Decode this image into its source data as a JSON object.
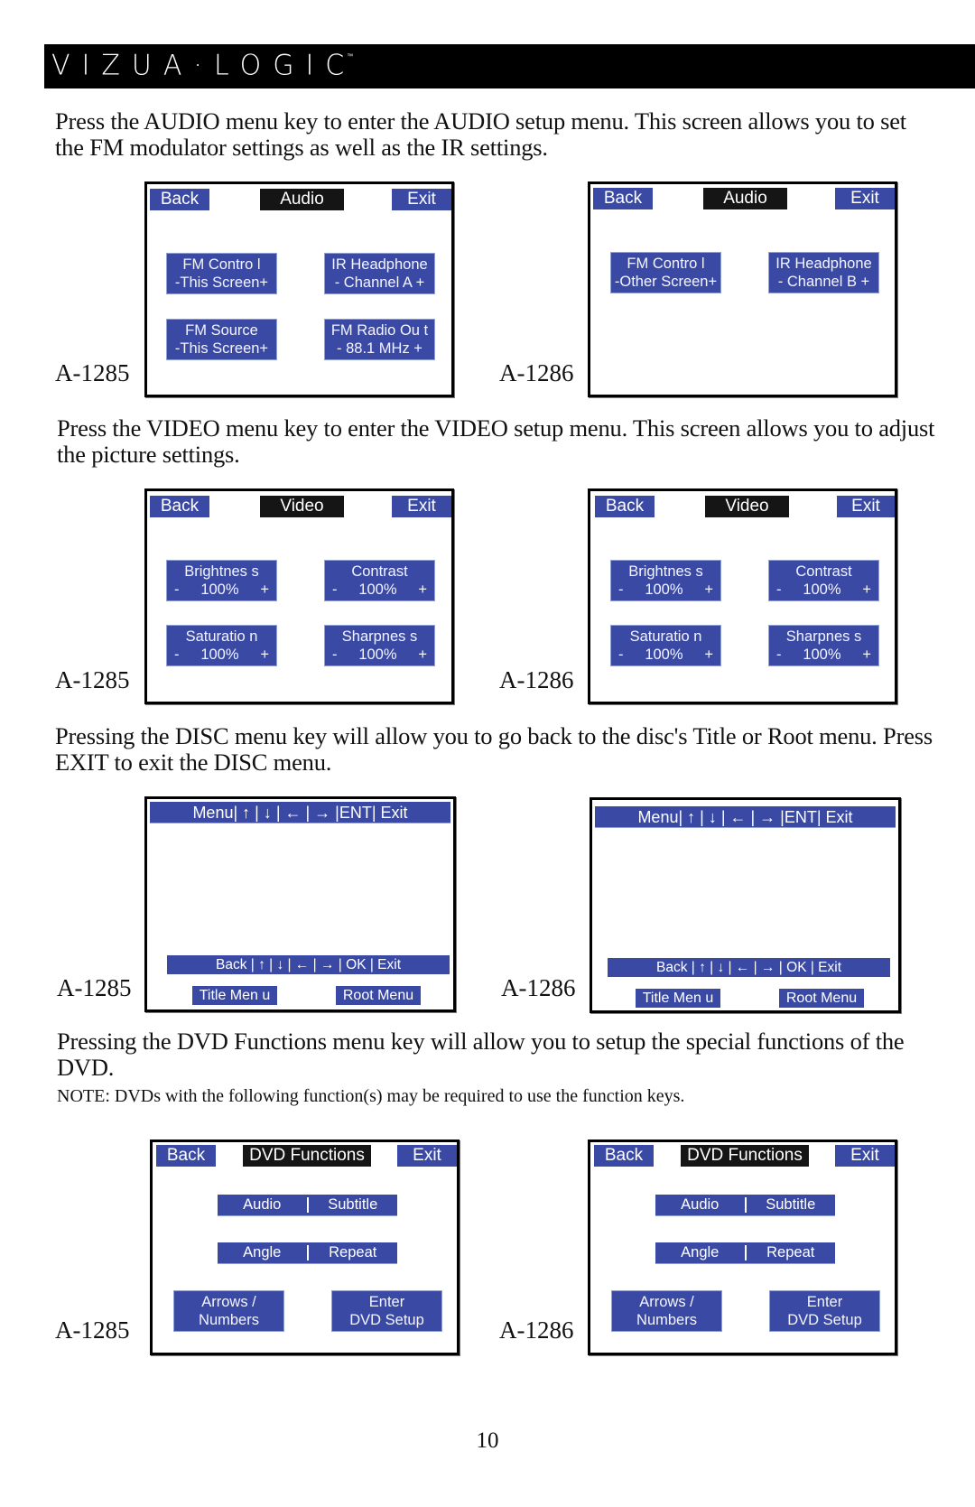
{
  "header": {
    "logo": "VIZUA·LOGIC",
    "trademark": "™"
  },
  "sections": {
    "audio": {
      "text": "Press the AUDIO menu key to enter the AUDIO setup menu.  This screen allows you to set the FM modulator settings as well as the IR settings.",
      "screens": [
        {
          "model": "A-1285",
          "back": "Back",
          "title": "Audio",
          "exit": "Exit",
          "buttons": [
            {
              "line1": "FM Contro l",
              "line2": "-This Screen+"
            },
            {
              "line1": "IR Headphone",
              "line2": "- Channel  A +"
            },
            {
              "line1": "FM Source",
              "line2": "-This Screen+"
            },
            {
              "line1": "FM Radio Ou t",
              "line2": "-  88.1 MHz  +"
            }
          ]
        },
        {
          "model": "A-1286",
          "back": "Back",
          "title": "Audio",
          "exit": "Exit",
          "buttons": [
            {
              "line1": "FM Contro l",
              "line2": "-Other Screen+"
            },
            {
              "line1": "IR Headphone",
              "line2": "- Channel B +"
            }
          ]
        }
      ]
    },
    "video": {
      "text": "Press the VIDEO menu key to enter the VIDEO setup menu.  This screen allows you to adjust the picture settings.",
      "screens": [
        {
          "model": "A-1285",
          "back": "Back",
          "title": "Video",
          "exit": "Exit",
          "buttons": [
            {
              "label": "Brightnes s",
              "minus": "-",
              "value": "100%",
              "plus": "+"
            },
            {
              "label": "Contrast",
              "minus": "-",
              "value": "100%",
              "plus": "+"
            },
            {
              "label": "Saturatio n",
              "minus": "-",
              "value": "100%",
              "plus": "+"
            },
            {
              "label": "Sharpnes s",
              "minus": "-",
              "value": "100%",
              "plus": "+"
            }
          ]
        },
        {
          "model": "A-1286",
          "back": "Back",
          "title": "Video",
          "exit": "Exit",
          "buttons": [
            {
              "label": "Brightnes s",
              "minus": "-",
              "value": "100%",
              "plus": "+"
            },
            {
              "label": "Contrast",
              "minus": "-",
              "value": "100%",
              "plus": "+"
            },
            {
              "label": "Saturatio n",
              "minus": "-",
              "value": "100%",
              "plus": "+"
            },
            {
              "label": "Sharpnes s",
              "minus": "-",
              "value": "100%",
              "plus": "+"
            }
          ]
        }
      ]
    },
    "disc": {
      "text": "Pressing the DISC menu key will allow you to go back to the disc's Title or Root menu. Press EXIT to exit the DISC menu.",
      "screens": [
        {
          "model": "A-1285",
          "top_bar": "Menu|  ↑  |  ↓  |  ←  |  →  |ENT| Exit",
          "bottom_bar": "Back |  ↑  |  ↓  |  ←  |  →  | OK  | Exit",
          "title_menu": "Title Men u",
          "root_menu": "Root Menu"
        },
        {
          "model": "A-1286",
          "top_bar": "Menu|  ↑  |  ↓  |  ←  |  →  |ENT| Exit",
          "bottom_bar": "Back |  ↑  |  ↓  |  ←  |  →  | OK  | Exit",
          "title_menu": "Title Men u",
          "root_menu": "Root Menu"
        }
      ]
    },
    "dvd": {
      "text": "Pressing the DVD Functions menu key will allow you to setup the special functions of the DVD.",
      "note": "NOTE: DVDs with the following function(s) may be required to use the function keys.",
      "screens": [
        {
          "model": "A-1285",
          "back": "Back",
          "title": "DVD Functions",
          "exit": "Exit",
          "row1": [
            "Audio",
            "Subtitle"
          ],
          "row2": [
            "Angle",
            "Repeat"
          ],
          "arrows": {
            "line1": "Arrows /",
            "line2": "Numbers"
          },
          "setup": {
            "line1": "Enter",
            "line2": "DVD Setup"
          }
        },
        {
          "model": "A-1286",
          "back": "Back",
          "title": "DVD Functions",
          "exit": "Exit",
          "row1": [
            "Audio",
            "Subtitle"
          ],
          "row2": [
            "Angle",
            "Repeat"
          ],
          "arrows": {
            "line1": "Arrows /",
            "line2": "Numbers"
          },
          "setup": {
            "line1": "Enter",
            "line2": "DVD Setup"
          }
        }
      ]
    }
  },
  "page_number": "10"
}
